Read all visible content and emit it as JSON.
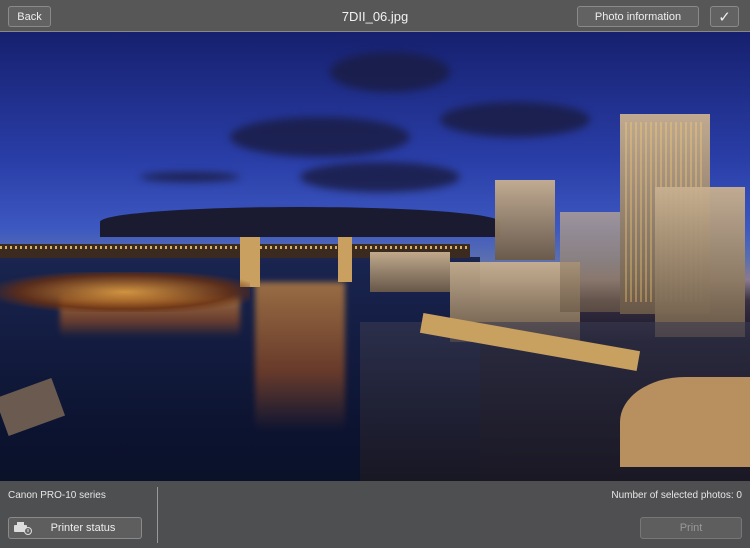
{
  "header": {
    "back_label": "Back",
    "title": "7DII_06.jpg",
    "photo_info_label": "Photo information",
    "confirm_icon": "checkmark-icon"
  },
  "footer": {
    "printer_name": "Canon PRO-10 series",
    "printer_status_label": "Printer status",
    "printer_status_icon": "printer-status-icon",
    "selected_count_label": "Number of selected photos: 0",
    "print_label": "Print"
  }
}
